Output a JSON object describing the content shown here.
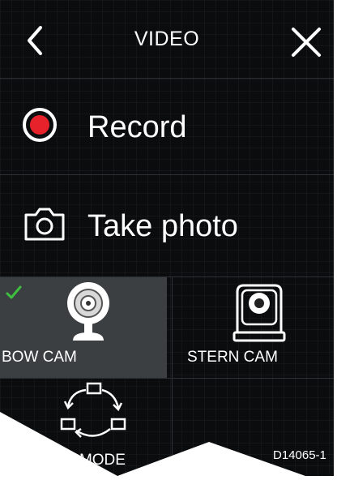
{
  "header": {
    "title": "VIDEO",
    "back_icon": "chevron-left-icon",
    "close_icon": "close-icon"
  },
  "menu": {
    "record": {
      "label": "Record",
      "icon": "record-icon",
      "accent": "#e8222b"
    },
    "photo": {
      "label": "Take photo",
      "icon": "camera-icon"
    }
  },
  "cameras": [
    {
      "label": "BOW CAM",
      "icon": "bow-camera-icon",
      "selected": true
    },
    {
      "label": "STERN CAM",
      "icon": "stern-camera-icon",
      "selected": false
    }
  ],
  "cycle_mode": {
    "label": "E MODE",
    "icon": "cycle-icon"
  },
  "selected_check_color": "#3fbf3f",
  "figure_code": "D14065-1"
}
